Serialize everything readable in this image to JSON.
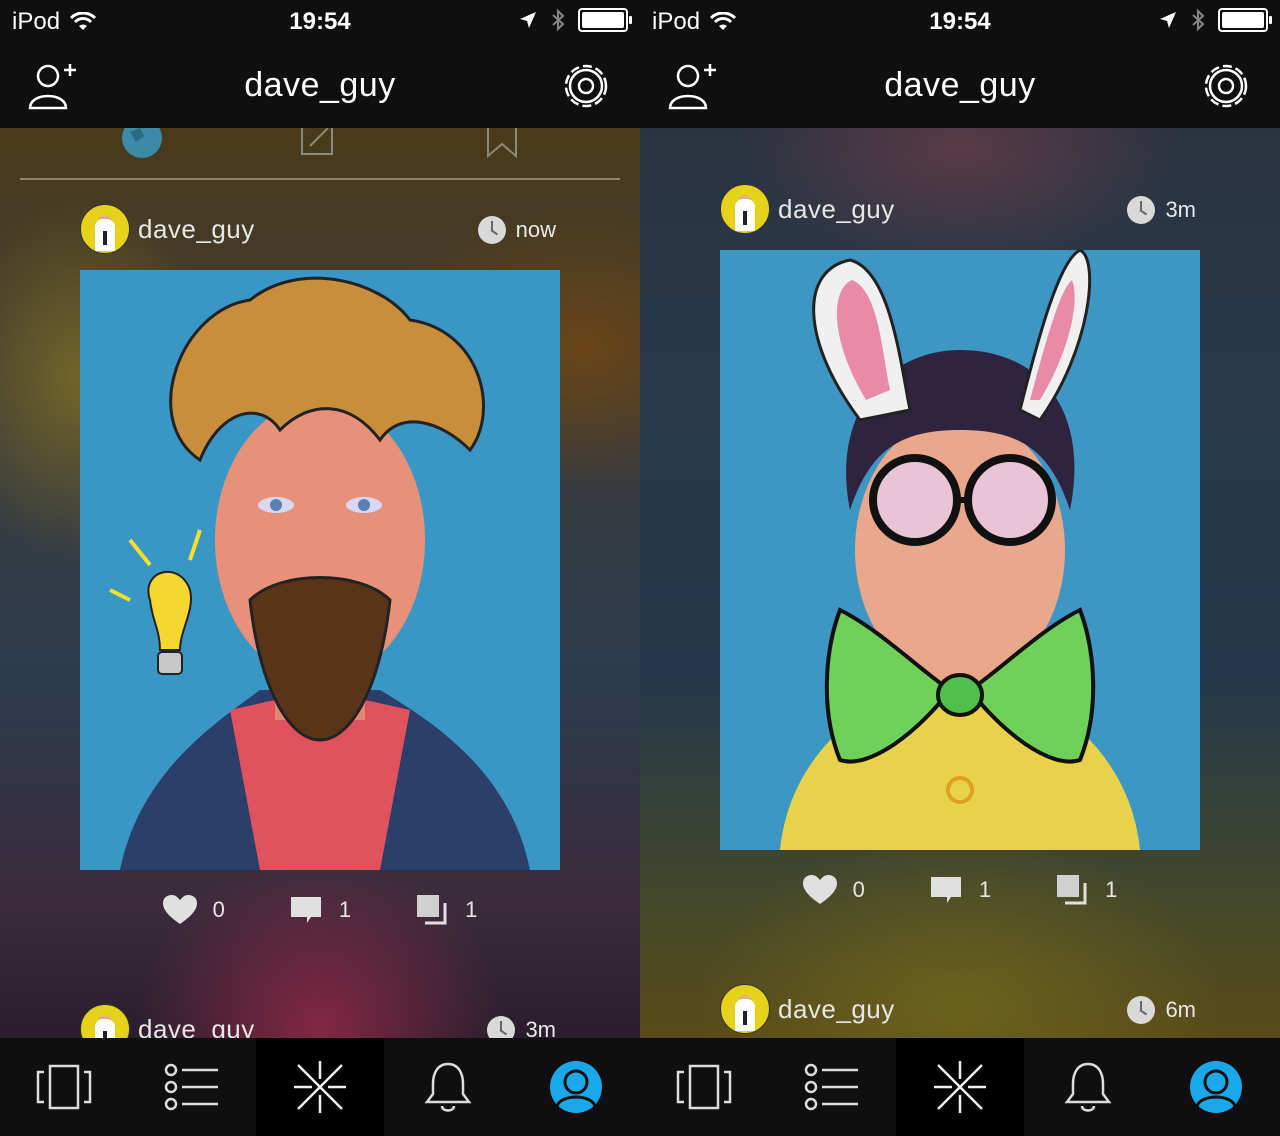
{
  "status": {
    "carrier": "iPod",
    "time": "19:54"
  },
  "navbar": {
    "title": "dave_guy"
  },
  "left_screen": {
    "post1": {
      "username": "dave_guy",
      "time": "now",
      "likes": "0",
      "comments": "1",
      "reposts": "1"
    },
    "post2": {
      "username": "dave_guy",
      "time": "3m"
    }
  },
  "right_screen": {
    "post1": {
      "username": "dave_guy",
      "time": "3m",
      "likes": "0",
      "comments": "1",
      "reposts": "1"
    },
    "post2": {
      "username": "dave_guy",
      "time": "6m"
    }
  },
  "colors": {
    "accent": "#1aa8e8",
    "bar": "#0f0f10"
  },
  "tabbar_icons": [
    "cards-icon",
    "list-icon",
    "sparkle-icon",
    "bell-icon",
    "profile-icon"
  ]
}
